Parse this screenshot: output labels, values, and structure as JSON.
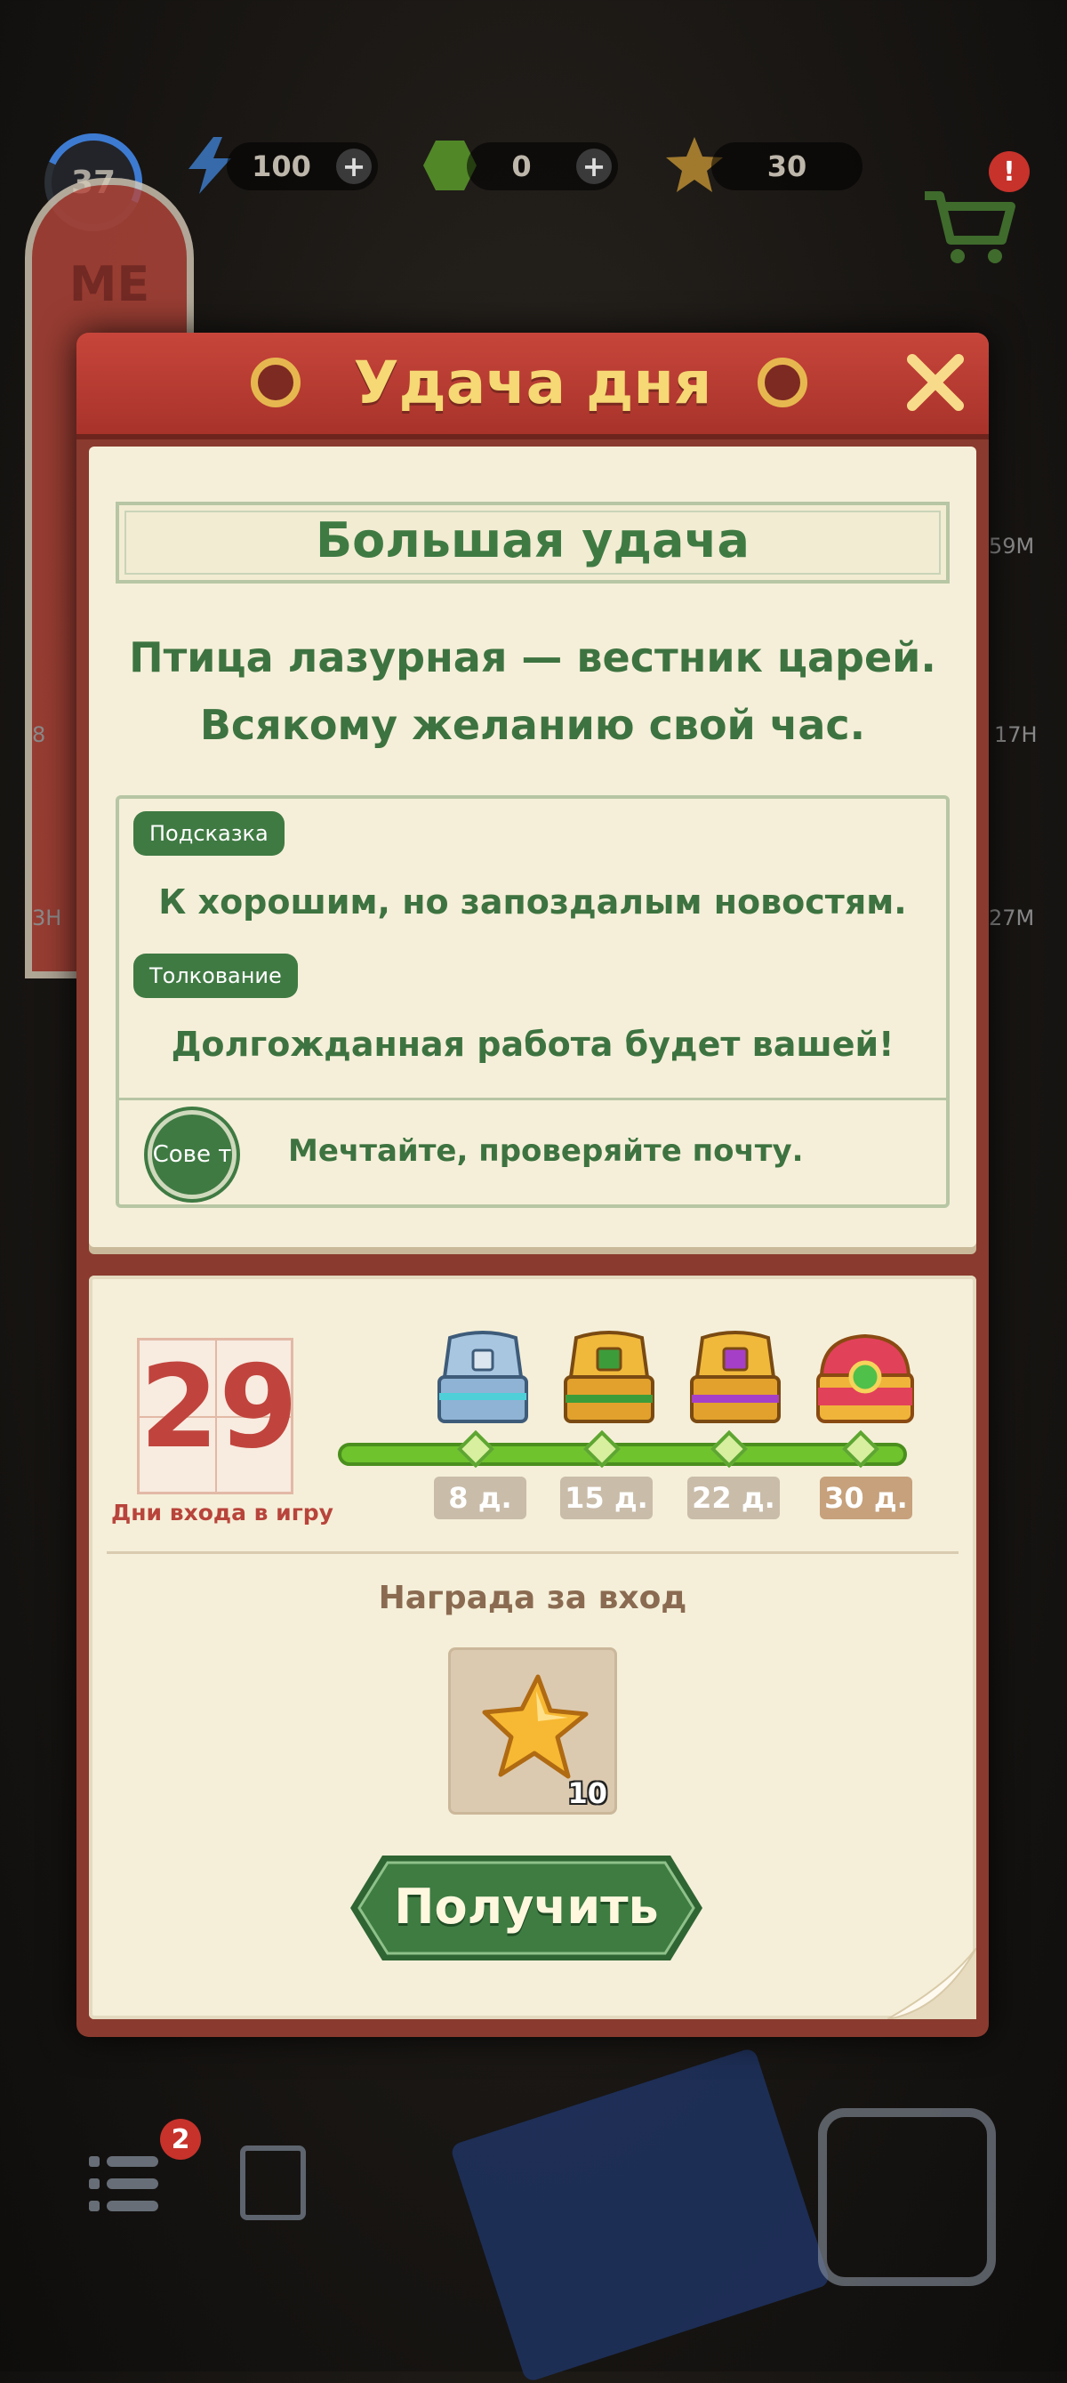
{
  "hud": {
    "level": "37",
    "energy": "100",
    "gems": "0",
    "stars": "30",
    "energy_plus": "+",
    "gems_plus": "+",
    "cart_alert": "!"
  },
  "background": {
    "menu_banner_text": "МЕ",
    "side_labels": [
      "59M",
      "17H",
      "27M",
      "8",
      "3H"
    ],
    "tasks_badge": "2"
  },
  "dialog": {
    "title": "Удача дня",
    "close_icon": "close-x",
    "fortune": {
      "level": "Большая удача",
      "line1": "Птица лазурная — вестник царей.",
      "line2": "Всякому желанию свой час.",
      "hint_tag": "Подсказка",
      "hint_text": "К хорошим, но запоздалым новостям.",
      "interpretation_tag": "Толкование",
      "interpretation_text": "Долгожданная работа будет вашей!",
      "advice_tag": "Сове т",
      "advice_text": "Мечтайте, проверяйте почту."
    },
    "login": {
      "days": "29",
      "days_caption": "Дни входа в игру",
      "progress_fraction": 0.967,
      "milestones": [
        {
          "label": "8 д.",
          "chest": "blue-chest"
        },
        {
          "label": "15 д.",
          "chest": "green-chest"
        },
        {
          "label": "22 д.",
          "chest": "purple-chest"
        },
        {
          "label": "30 д.",
          "chest": "gold-chest"
        }
      ],
      "reward_title": "Награда за вход",
      "reward_item": "star-icon",
      "reward_count": "10",
      "claim_label": "Получить"
    }
  },
  "colors": {
    "header_red": "#b83b31",
    "title_gold": "#f6d874",
    "paper": "#f5efd9",
    "text_green": "#3d7340",
    "progress_green": "#6fc32c",
    "button_green": "#3e7c42",
    "calendar_red": "#c0443d"
  }
}
